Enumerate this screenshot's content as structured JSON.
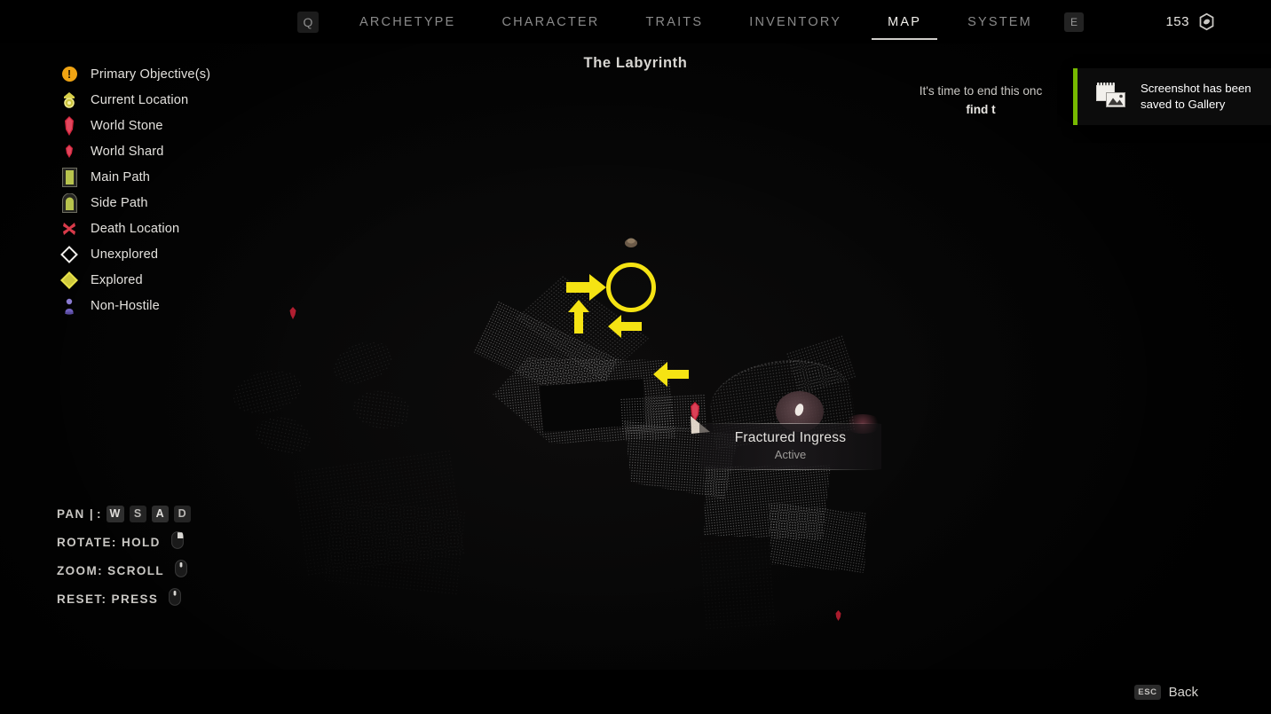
{
  "nav": {
    "quest_badge": "Q",
    "tabs": [
      {
        "label": "ARCHETYPE",
        "active": false
      },
      {
        "label": "CHARACTER",
        "active": false
      },
      {
        "label": "TRAITS",
        "active": false
      },
      {
        "label": "INVENTORY",
        "active": false
      },
      {
        "label": "MAP",
        "active": true
      },
      {
        "label": "SYSTEM",
        "active": false
      }
    ],
    "emote_badge": "E",
    "currency": {
      "value": "153",
      "icon": "scrap-icon"
    }
  },
  "map": {
    "title": "The Labyrinth",
    "legend": [
      {
        "label": "Primary Objective(s)",
        "icon": "objective-icon",
        "color": "#f0a413"
      },
      {
        "label": "Current Location",
        "icon": "current-location-icon",
        "color": "#e3d84a"
      },
      {
        "label": "World Stone",
        "icon": "world-stone-icon",
        "color": "#e0324a"
      },
      {
        "label": "World Shard",
        "icon": "world-shard-icon",
        "color": "#e0324a"
      },
      {
        "label": "Main Path",
        "icon": "main-path-door-icon",
        "color": "#b9c44a"
      },
      {
        "label": "Side Path",
        "icon": "side-path-door-icon",
        "color": "#b9c44a"
      },
      {
        "label": "Death Location",
        "icon": "death-location-icon",
        "color": "#d93b4a"
      },
      {
        "label": "Unexplored",
        "icon": "unexplored-diamond-icon",
        "color": "#f4f2ee"
      },
      {
        "label": "Explored",
        "icon": "explored-diamond-icon",
        "color": "#cfc93c"
      },
      {
        "label": "Non-Hostile",
        "icon": "non-hostile-icon",
        "color": "#7a6bc4"
      }
    ],
    "marker_tooltip": {
      "name": "Fractured Ingress",
      "state": "Active"
    },
    "annotations": {
      "highlight_circle_color": "#f5e313",
      "arrow_color": "#f5e313",
      "arrow_count": "4"
    }
  },
  "controls": [
    {
      "label": "PAN |",
      "keys": [
        "W",
        "S",
        "A",
        "D"
      ],
      "icon": ""
    },
    {
      "label": "ROTATE: HOLD",
      "keys": [],
      "icon": "mouse-right-button-icon"
    },
    {
      "label": "ZOOM: SCROLL",
      "keys": [],
      "icon": "mouse-wheel-icon"
    },
    {
      "label": "RESET: PRESS",
      "keys": [],
      "icon": "mouse-wheel-icon"
    }
  ],
  "quest": {
    "line1": "It's time to end this onc",
    "line2": "find t"
  },
  "toast": {
    "message": "Screenshot has been saved to Gallery",
    "icon": "gallery-photo-icon",
    "accent_color": "#76b900"
  },
  "footer": {
    "key": "ESC",
    "label": "Back"
  }
}
